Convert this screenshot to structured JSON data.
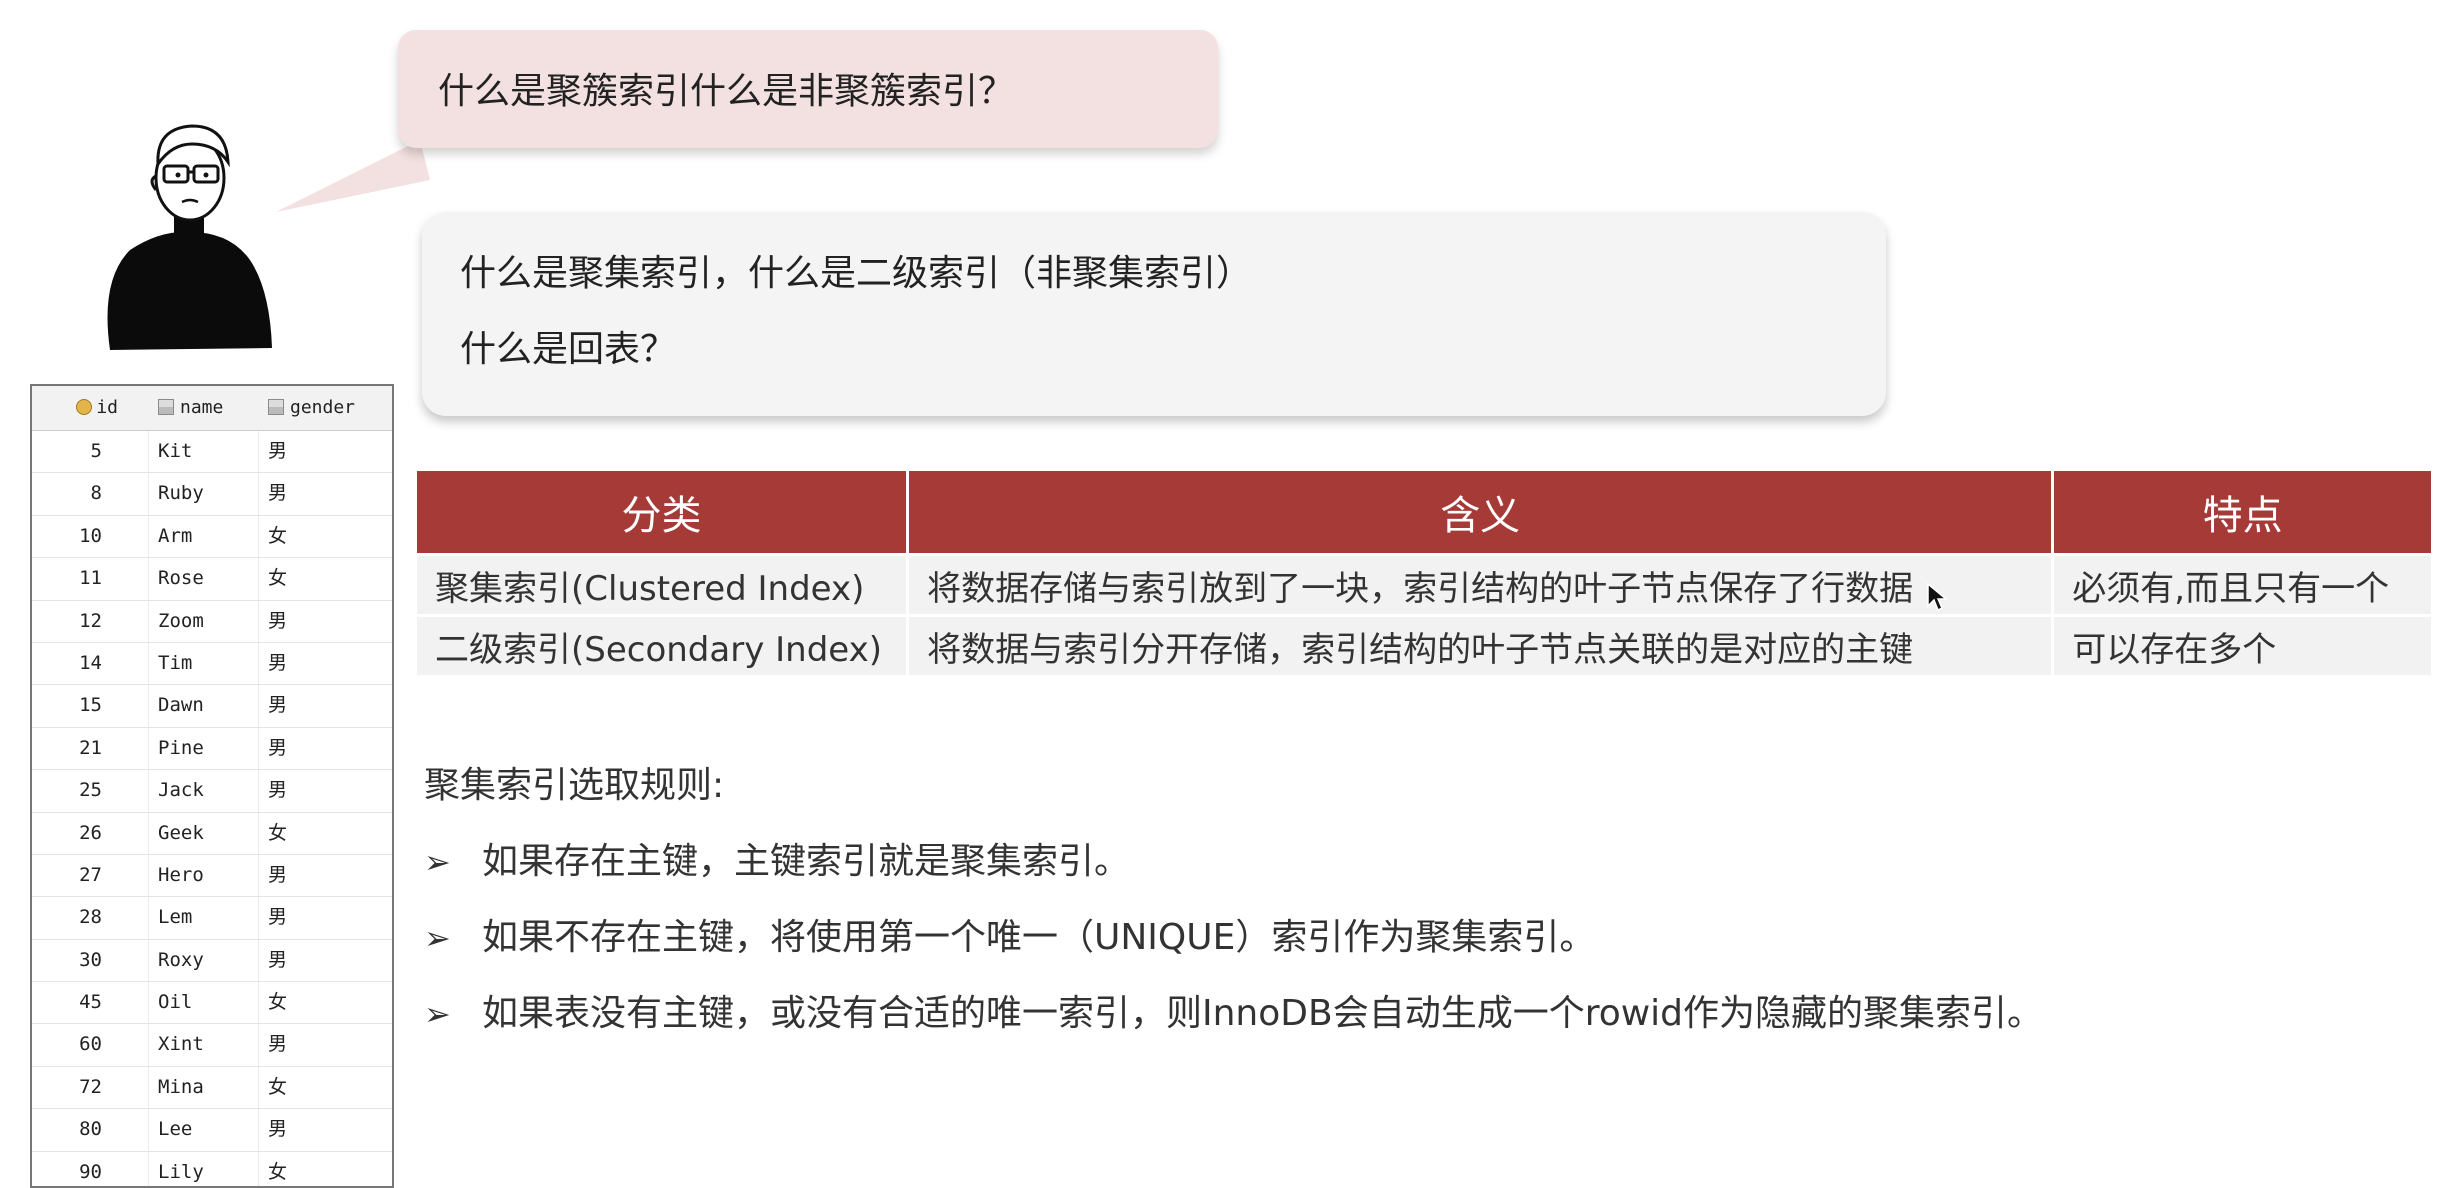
{
  "question": "什么是聚簇索引什么是非聚簇索引？",
  "topic": {
    "line1": "什么是聚集索引，什么是二级索引（非聚集索引）",
    "line2": "什么是回表？"
  },
  "db_table": {
    "headers": {
      "id": "id",
      "name": "name",
      "gender": "gender"
    },
    "rows": [
      {
        "id": "5",
        "name": "Kit",
        "gender": "男"
      },
      {
        "id": "8",
        "name": "Ruby",
        "gender": "男"
      },
      {
        "id": "10",
        "name": "Arm",
        "gender": "女"
      },
      {
        "id": "11",
        "name": "Rose",
        "gender": "女"
      },
      {
        "id": "12",
        "name": "Zoom",
        "gender": "男"
      },
      {
        "id": "14",
        "name": "Tim",
        "gender": "男"
      },
      {
        "id": "15",
        "name": "Dawn",
        "gender": "男"
      },
      {
        "id": "21",
        "name": "Pine",
        "gender": "男"
      },
      {
        "id": "25",
        "name": "Jack",
        "gender": "男"
      },
      {
        "id": "26",
        "name": "Geek",
        "gender": "女"
      },
      {
        "id": "27",
        "name": "Hero",
        "gender": "男"
      },
      {
        "id": "28",
        "name": "Lem",
        "gender": "男"
      },
      {
        "id": "30",
        "name": "Roxy",
        "gender": "男"
      },
      {
        "id": "45",
        "name": "Oil",
        "gender": "女"
      },
      {
        "id": "60",
        "name": "Xint",
        "gender": "男"
      },
      {
        "id": "72",
        "name": "Mina",
        "gender": "女"
      },
      {
        "id": "80",
        "name": "Lee",
        "gender": "男"
      },
      {
        "id": "90",
        "name": "Lily",
        "gender": "女"
      }
    ]
  },
  "compare_table": {
    "headers": [
      "分类",
      "含义",
      "特点"
    ],
    "rows": [
      [
        "聚集索引(Clustered Index)",
        "将数据存储与索引放到了一块，索引结构的叶子节点保存了行数据",
        "必须有,而且只有一个"
      ],
      [
        "二级索引(Secondary Index)",
        "将数据与索引分开存储，索引结构的叶子节点关联的是对应的主键",
        "可以存在多个"
      ]
    ]
  },
  "rules": {
    "title": "聚集索引选取规则:",
    "arrow": "➢",
    "items": [
      "如果存在主键，主键索引就是聚集索引。",
      "如果不存在主键，将使用第一个唯一（UNIQUE）索引作为聚集索引。",
      "如果表没有主键，或没有合适的唯一索引，则InnoDB会自动生成一个rowid作为隐藏的聚集索引。"
    ]
  },
  "colors": {
    "header_red": "#a63a36",
    "question_bubble": "#f3e0e0",
    "topic_bubble": "#f4f4f4",
    "cell_bg": "#f2f2f2"
  }
}
